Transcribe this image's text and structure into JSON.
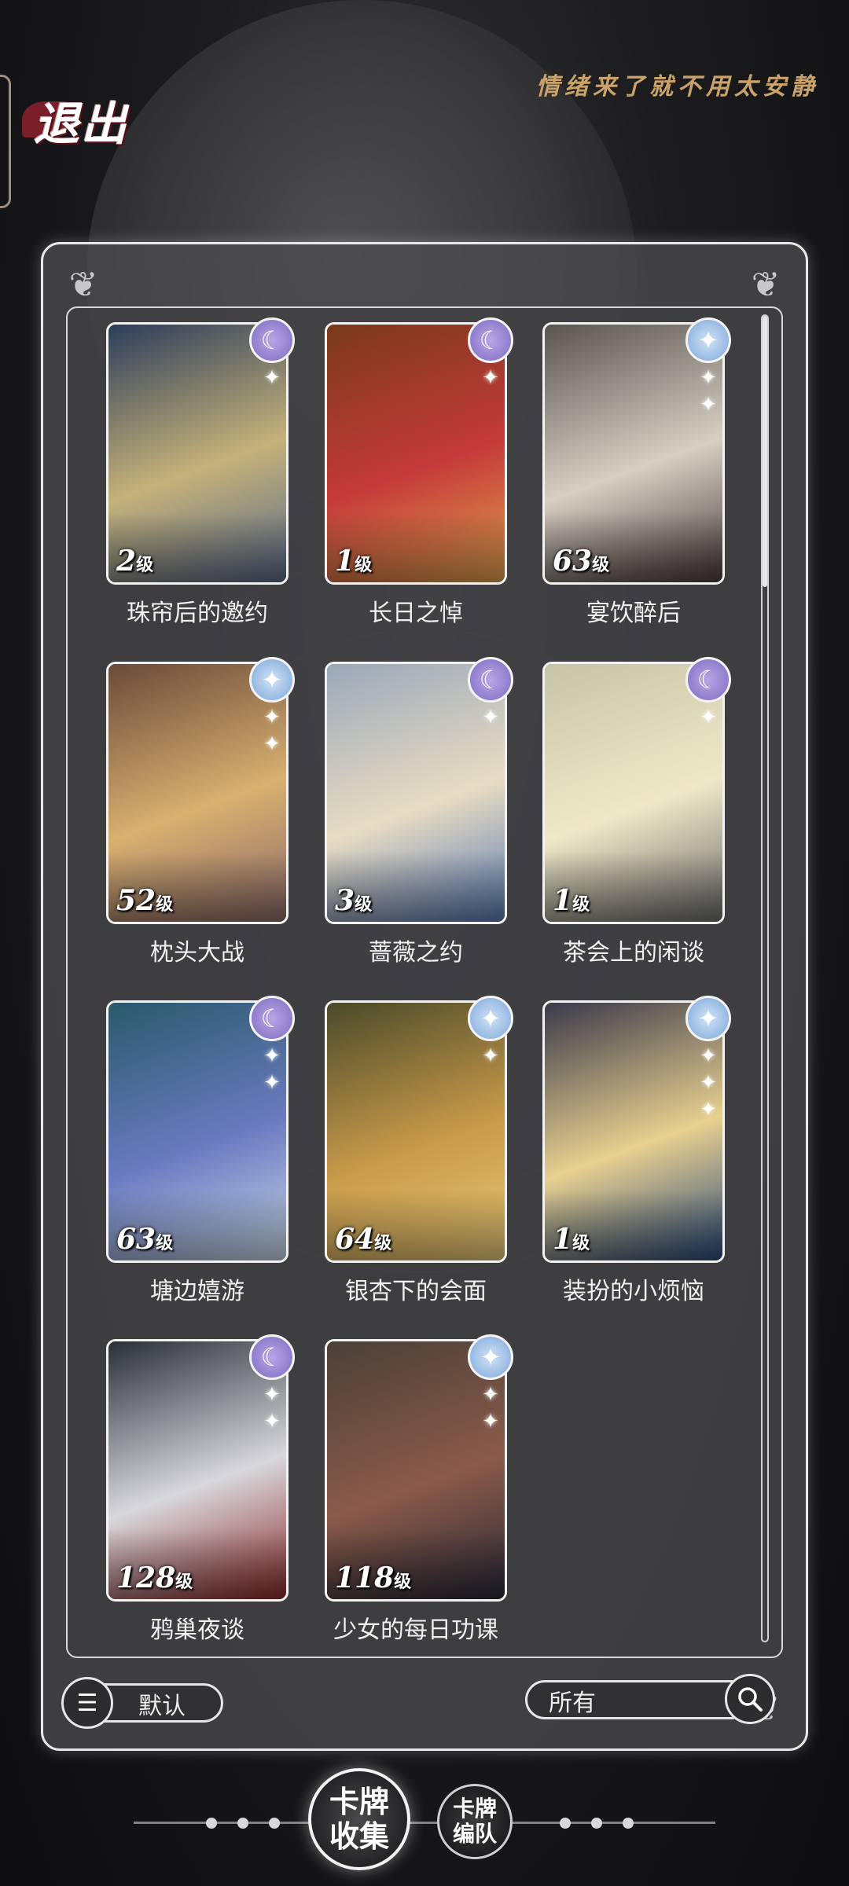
{
  "header": {
    "exit_label": "退出",
    "slogan": "情绪来了就不用太安静"
  },
  "cards": [
    {
      "title": "珠帘后的邀约",
      "level": "2",
      "level_unit": "级",
      "badge": "moon-icon",
      "stars": 1,
      "colors": [
        "#2d3d5a",
        "#c4b27a",
        "#5a6a8a"
      ]
    },
    {
      "title": "长日之悼",
      "level": "1",
      "level_unit": "级",
      "badge": "moon-icon",
      "stars": 1,
      "colors": [
        "#7a3a1a",
        "#c43a3a",
        "#e0a050"
      ]
    },
    {
      "title": "宴饮醉后",
      "level": "63",
      "level_unit": "级",
      "badge": "star-icon",
      "stars": 2,
      "colors": [
        "#5a5450",
        "#d8cfc3",
        "#4a3a3a"
      ]
    },
    {
      "title": "枕头大战",
      "level": "52",
      "level_unit": "级",
      "badge": "star-icon",
      "stars": 2,
      "colors": [
        "#6a4a3a",
        "#d8b070",
        "#8a6a6a"
      ]
    },
    {
      "title": "蔷薇之约",
      "level": "3",
      "level_unit": "级",
      "badge": "moon-icon",
      "stars": 1,
      "colors": [
        "#9aa8b8",
        "#e8dcc4",
        "#5a7ab0"
      ]
    },
    {
      "title": "茶会上的闲谈",
      "level": "1",
      "level_unit": "级",
      "badge": "moon-icon",
      "stars": 1,
      "colors": [
        "#c8c4a8",
        "#f0e8c8",
        "#6a6a6a"
      ]
    },
    {
      "title": "塘边嬉游",
      "level": "63",
      "level_unit": "级",
      "badge": "moon-icon",
      "stars": 2,
      "colors": [
        "#2a5a6a",
        "#6a7ac0",
        "#c8d8e8"
      ]
    },
    {
      "title": "银杏下的会面",
      "level": "64",
      "level_unit": "级",
      "badge": "star-icon",
      "stars": 1,
      "colors": [
        "#4a4a2a",
        "#c89a4a",
        "#e8c878"
      ]
    },
    {
      "title": "装扮的小烦恼",
      "level": "1",
      "level_unit": "级",
      "badge": "star-icon",
      "stars": 3,
      "colors": [
        "#3a3a4a",
        "#e8d090",
        "#2a4a7a"
      ]
    },
    {
      "title": "鸦巢夜谈",
      "level": "128",
      "level_unit": "级",
      "badge": "moon-icon",
      "stars": 2,
      "colors": [
        "#2a3038",
        "#d8d8dc",
        "#8a2a2a"
      ]
    },
    {
      "title": "少女的每日功课",
      "level": "118",
      "level_unit": "级",
      "badge": "star-icon",
      "stars": 2,
      "colors": [
        "#4a4038",
        "#8a5a4a",
        "#2a2a38"
      ]
    }
  ],
  "footer": {
    "sort_label": "默认",
    "filter_label": "所有"
  },
  "nav": {
    "collection_label": "卡牌收集",
    "team_label": "卡牌编队"
  }
}
